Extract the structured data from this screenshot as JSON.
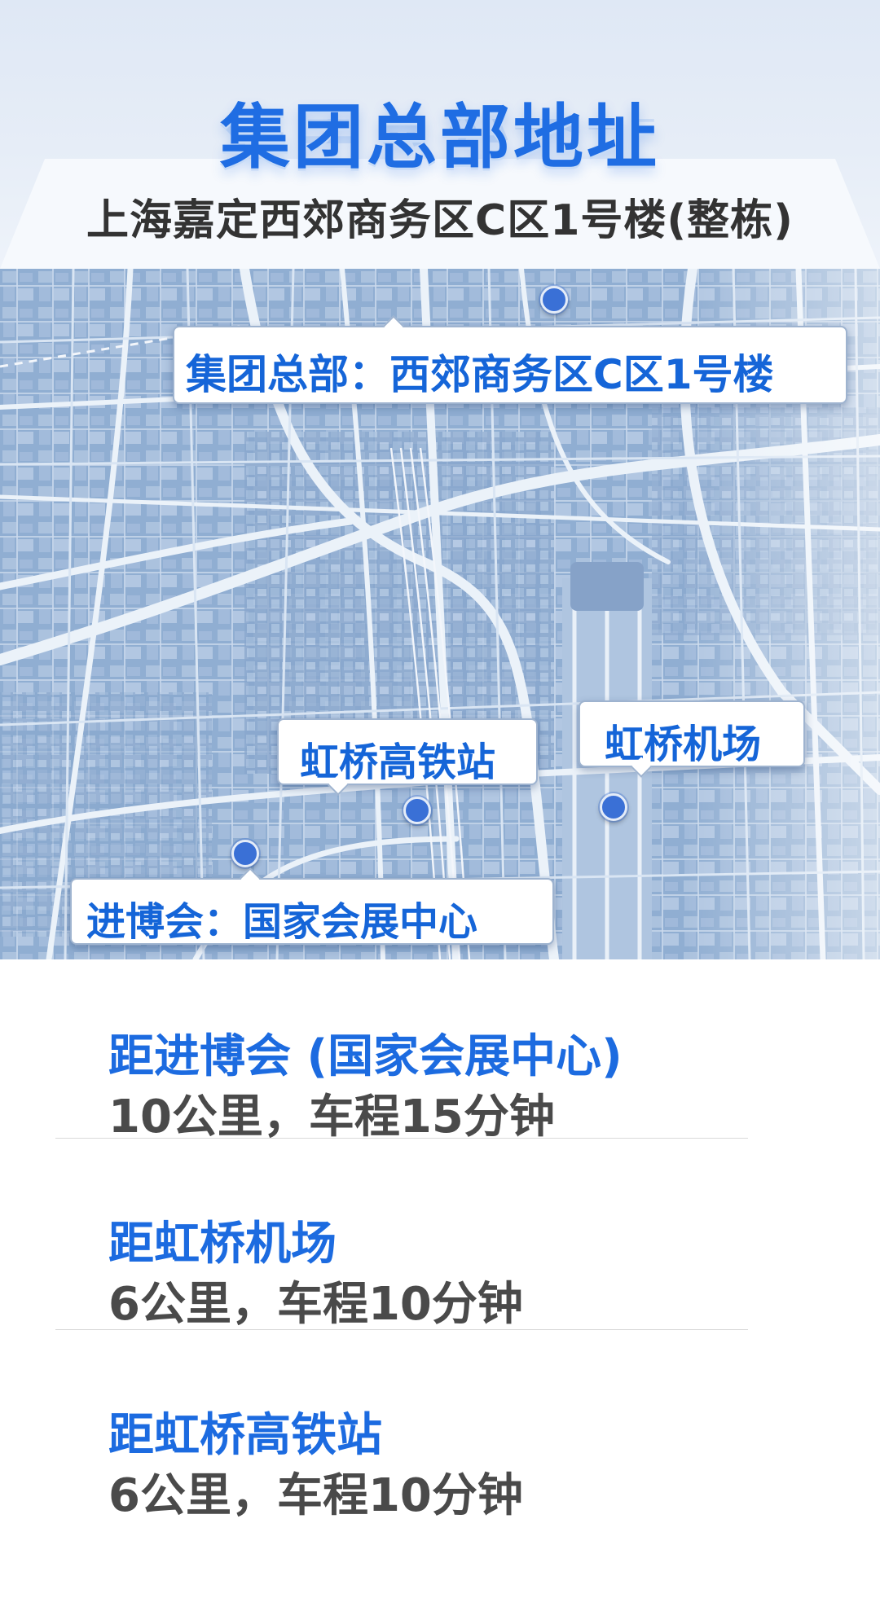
{
  "header": {
    "title": "集团总部地址",
    "address": "上海嘉定西郊商务区C区1号楼(整栋)"
  },
  "map": {
    "callouts": {
      "headquarters": "集团总部：西郊商务区C区1号楼",
      "railway_station": "虹桥高铁站",
      "airport": "虹桥机场",
      "expo": "进博会：国家会展中心"
    },
    "pin_color": "#3a70d6"
  },
  "distances": [
    {
      "title": "距进博会 (国家会展中心)",
      "value": "10公里，车程15分钟"
    },
    {
      "title": "距虹桥机场",
      "value": "6公里，车程10分钟"
    },
    {
      "title": "距虹桥高铁站",
      "value": "6公里，车程10分钟"
    }
  ],
  "colors": {
    "accent": "#1f6de3",
    "text": "#4a4a4a"
  }
}
